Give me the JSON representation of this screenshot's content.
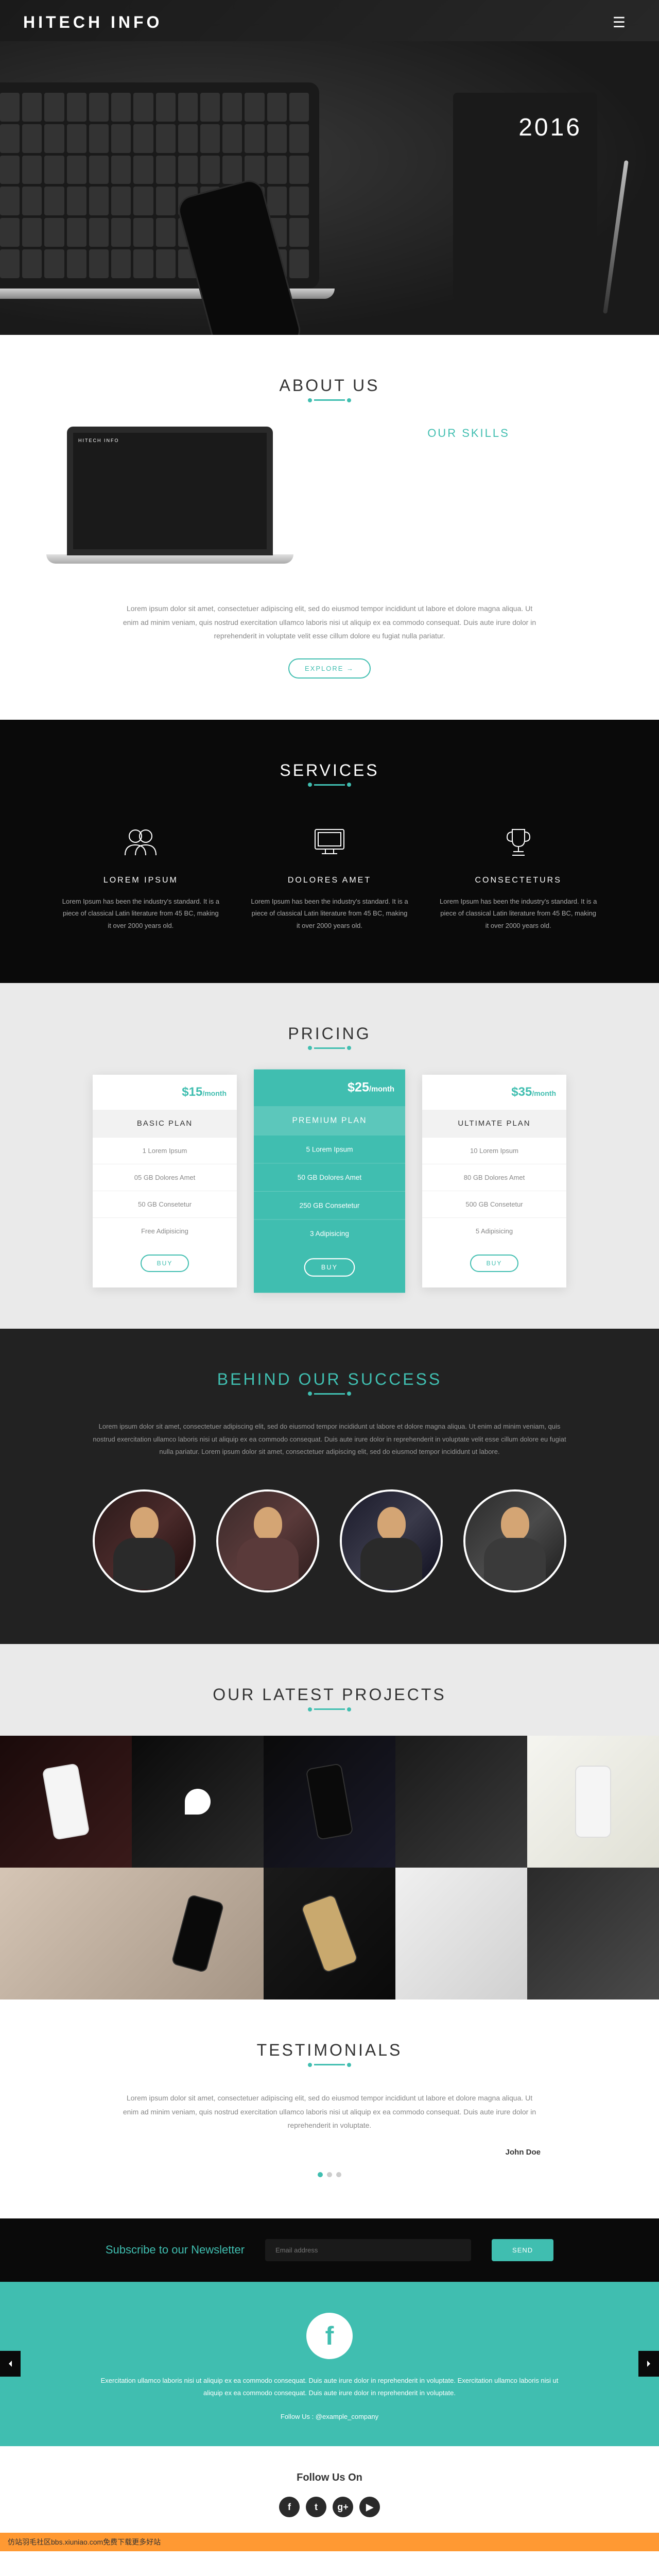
{
  "header": {
    "logo": "HITECH INFO",
    "notebook_year": "2016"
  },
  "about": {
    "title": "ABOUT US",
    "skills_title": "OUR SKILLS",
    "screen_logo": "HITECH INFO",
    "text": "Lorem ipsum dolor sit amet, consectetuer adipiscing elit, sed do eiusmod tempor incididunt ut labore et dolore magna aliqua. Ut enim ad minim veniam, quis nostrud exercitation ullamco laboris nisi ut aliquip ex ea commodo consequat. Duis aute irure dolor in reprehenderit in voluptate velit esse cillum dolore eu fugiat nulla pariatur.",
    "button": "EXPLORE  →"
  },
  "services": {
    "title": "SERVICES",
    "items": [
      {
        "title": "LOREM IPSUM",
        "text": "Lorem Ipsum has been the industry's standard. It is a piece of classical Latin literature from 45 BC, making it over 2000 years old."
      },
      {
        "title": "DOLORES AMET",
        "text": "Lorem Ipsum has been the industry's standard. It is a piece of classical Latin literature from 45 BC, making it over 2000 years old."
      },
      {
        "title": "CONSECTETURS",
        "text": "Lorem Ipsum has been the industry's standard. It is a piece of classical Latin literature from 45 BC, making it over 2000 years old."
      }
    ]
  },
  "pricing": {
    "title": "PRICING",
    "plans": [
      {
        "price": "$15",
        "period": "/month",
        "name": "BASIC PLAN",
        "f1": "1 Lorem Ipsum",
        "f2": "05 GB Dolores Amet",
        "f3": "50 GB Consetetur",
        "f4": "Free Adipisicing",
        "buy": "BUY"
      },
      {
        "price": "$25",
        "period": "/month",
        "name": "PREMIUM PLAN",
        "f1": "5 Lorem Ipsum",
        "f2": "50 GB Dolores Amet",
        "f3": "250 GB Consetetur",
        "f4": "3 Adipisicing",
        "buy": "BUY"
      },
      {
        "price": "$35",
        "period": "/month",
        "name": "ULTIMATE PLAN",
        "f1": "10 Lorem Ipsum",
        "f2": "80 GB Dolores Amet",
        "f3": "500 GB Consetetur",
        "f4": "5 Adipisicing",
        "buy": "BUY"
      }
    ]
  },
  "team": {
    "title": "BEHIND OUR SUCCESS",
    "text": "Lorem ipsum dolor sit amet, consectetuer adipiscing elit, sed do eiusmod tempor incididunt ut labore et dolore magna aliqua. Ut enim ad minim veniam, quis nostrud exercitation ullamco laboris nisi ut aliquip ex ea commodo consequat. Duis aute irure dolor in reprehenderit in voluptate velit esse cillum dolore eu fugiat nulla pariatur. Lorem ipsum dolor sit amet, consectetuer adipiscing elit, sed do eiusmod tempor incididunt ut labore."
  },
  "projects": {
    "title": "OUR LATEST PROJECTS"
  },
  "testimonials": {
    "title": "TESTIMONIALS",
    "text": "Lorem ipsum dolor sit amet, consectetuer adipiscing elit, sed do eiusmod tempor incididunt ut labore et dolore magna aliqua. Ut enim ad minim veniam, quis nostrud exercitation ullamco laboris nisi ut aliquip ex ea commodo consequat. Duis aute irure dolor in reprehenderit in voluptate.",
    "author": "John Doe"
  },
  "newsletter": {
    "title": "Subscribe to our Newsletter",
    "placeholder": "Email address",
    "button": "SEND"
  },
  "social": {
    "icon": "f",
    "text": "Exercitation ullamco laboris nisi ut aliquip ex ea commodo consequat. Duis aute irure dolor in reprehenderit in voluptate. Exercitation ullamco laboris nisi ut aliquip ex ea commodo consequat. Duis aute irure dolor in reprehenderit in voluptate.",
    "follow": "Follow Us : @example_company"
  },
  "footer": {
    "title": "Follow Us On",
    "icons": {
      "fb": "f",
      "tw": "t",
      "gp": "g+",
      "yt": "▶"
    }
  },
  "watermark": "仿站羽毛社区bbs.xiuniao.com免费下载更多好站"
}
